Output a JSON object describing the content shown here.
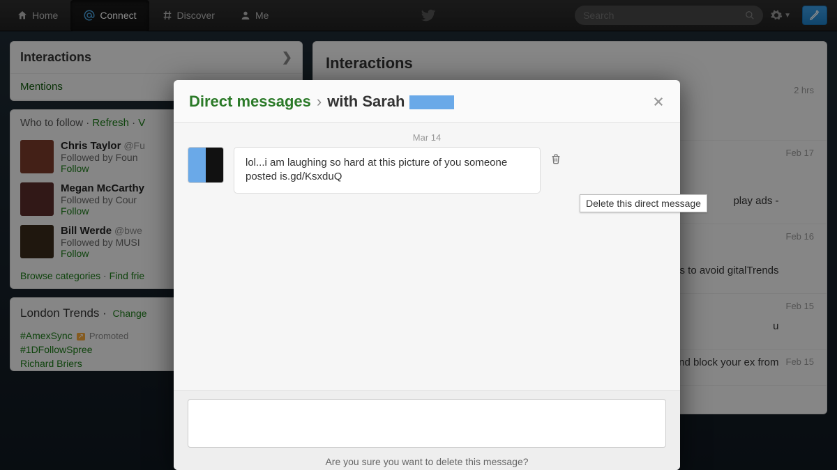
{
  "nav": {
    "home": "Home",
    "connect": "Connect",
    "discover": "Discover",
    "me": "Me",
    "search_placeholder": "Search"
  },
  "left": {
    "interactions": "Interactions",
    "mentions": "Mentions",
    "who_title": "Who to follow",
    "refresh": "Refresh",
    "view_all_short": "V",
    "people": [
      {
        "name": "Chris Taylor",
        "handle": "@Fu",
        "followed_by": "Followed by Foun",
        "follow": "Follow"
      },
      {
        "name": "Megan McCarthy",
        "handle": "",
        "followed_by": "Followed by Cour",
        "follow": "Follow"
      },
      {
        "name": "Bill Werde",
        "handle": "@bwe",
        "followed_by": "Followed by MUSI",
        "follow": "Follow"
      }
    ],
    "browse": "Browse categories",
    "find_friends": "Find frie",
    "trends_title": "London Trends",
    "change": "Change",
    "trends": [
      "#AmexSync",
      "#1DFollowSpree",
      "Richard Briers"
    ],
    "promoted": "Promoted"
  },
  "main": {
    "title": "Interactions",
    "items": [
      {
        "text": "",
        "time": "2 hrs"
      },
      {
        "text": "play ads -",
        "time": "Feb 17"
      },
      {
        "text": "acked - tips to avoid   gitalTrends",
        "time": "Feb 16"
      },
      {
        "text": "u",
        "time": "Feb 15"
      },
      {
        "text": "nd block your ex from",
        "time": "Feb 15"
      }
    ]
  },
  "modal": {
    "dm_link": "Direct messages",
    "sep": "›",
    "with": "with Sarah",
    "date": "Mar 14",
    "message": "lol...i am laughing so hard at this picture of you someone posted is.gd/KsxduQ",
    "confirm": "Are you sure you want to delete this message?"
  },
  "tooltip": "Delete this direct message"
}
